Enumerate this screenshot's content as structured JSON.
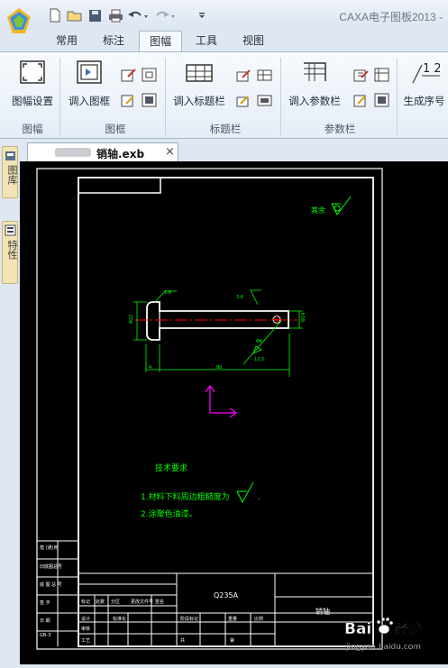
{
  "app": {
    "title": "CAXA电子图板2013 -"
  },
  "quick_access": {
    "items": [
      "new-file",
      "open-file",
      "save",
      "print",
      "undo",
      "redo",
      "customize"
    ]
  },
  "ribbon": {
    "tabs": [
      {
        "label": "常用",
        "active": false
      },
      {
        "label": "标注",
        "active": false
      },
      {
        "label": "图幅",
        "active": true
      },
      {
        "label": "工具",
        "active": false
      },
      {
        "label": "视图",
        "active": false
      }
    ],
    "groups": [
      {
        "label": "图幅",
        "buttons": [
          "图幅设置"
        ]
      },
      {
        "label": "图框",
        "buttons": [
          "调入图框"
        ]
      },
      {
        "label": "标题栏",
        "buttons": [
          "调入标题栏"
        ]
      },
      {
        "label": "参数栏",
        "buttons": [
          "调入参数栏"
        ]
      },
      {
        "label": "",
        "buttons": [
          "生成序号"
        ]
      }
    ],
    "sequence_icon_text": "1 2"
  },
  "dock": {
    "tabs": [
      "图库",
      "特性"
    ]
  },
  "document": {
    "tab_label": "销轴.exb",
    "close_glyph": "×"
  },
  "drawing": {
    "roughness_note": "其余",
    "dim_labels": {
      "chamfer": "1.6",
      "roughness_top": "3.6",
      "diameter_left": "Φ22",
      "diameter_right": "Φ14",
      "roughness_bottom": "Φ6",
      "roughness_bottom2": "12.5",
      "head_width": "4",
      "length": "80"
    },
    "tech_title": "技术要求",
    "tech_req_1": "1.材料下料周边粗糙度为",
    "tech_req_2": "2.涂聚色油漆。",
    "title_block": {
      "material": "Q235A",
      "part_name": "销轴"
    }
  },
  "watermark": {
    "brand": "Bai",
    "brand_suffix": "经验",
    "url": "jingyan.baidu.com"
  },
  "colors": {
    "canvas_bg": "#000000",
    "line_white": "#ffffff",
    "annotation_green": "#00ff00",
    "centerline_red": "#ff0000",
    "axis_magenta": "#ff00ff",
    "ribbon_bg": "#e5edf7"
  }
}
